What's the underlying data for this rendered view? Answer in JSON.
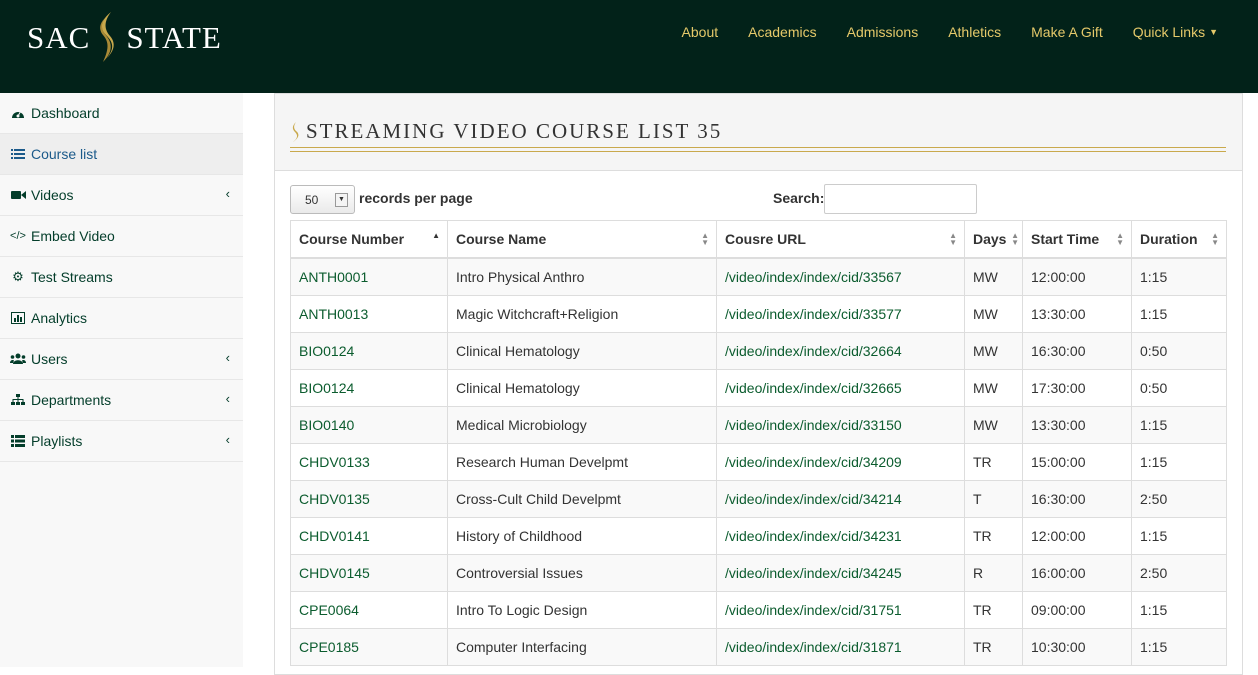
{
  "brand": {
    "left": "SAC",
    "right": "STATE",
    "logo_icon": "flame-s-icon",
    "gold": "#c9a94c",
    "header_bg": "#022219"
  },
  "topnav": [
    {
      "label": "About"
    },
    {
      "label": "Academics"
    },
    {
      "label": "Admissions"
    },
    {
      "label": "Athletics"
    },
    {
      "label": "Make A Gift"
    },
    {
      "label": "Quick Links"
    }
  ],
  "sidebar": {
    "items": [
      {
        "label": "Dashboard",
        "icon": "dashboard-icon"
      },
      {
        "label": "Course list",
        "icon": "list-icon"
      },
      {
        "label": "Videos",
        "icon": "video-camera-icon"
      },
      {
        "label": "Embed Video",
        "icon": "code-icon"
      },
      {
        "label": "Test Streams",
        "icon": "cogs-icon"
      },
      {
        "label": "Analytics",
        "icon": "bar-chart-icon"
      },
      {
        "label": "Users",
        "icon": "users-icon"
      },
      {
        "label": "Departments",
        "icon": "sitemap-icon"
      },
      {
        "label": "Playlists",
        "icon": "th-list-icon"
      }
    ]
  },
  "page": {
    "title": "STREAMING VIDEO COURSE LIST 35"
  },
  "controls": {
    "page_size": "50",
    "records_label": "records per page",
    "search_label": "Search:",
    "search_value": ""
  },
  "table": {
    "columns": [
      "Course Number",
      "Course Name",
      "Cousre URL",
      "Days",
      "Start Time",
      "Duration"
    ],
    "rows": [
      [
        "ANTH0001",
        "Intro Physical Anthro",
        "/video/index/index/cid/33567",
        "MW",
        "12:00:00",
        "1:15"
      ],
      [
        "ANTH0013",
        "Magic Witchcraft+Religion",
        "/video/index/index/cid/33577",
        "MW",
        "13:30:00",
        "1:15"
      ],
      [
        "BIO0124",
        "Clinical Hematology",
        "/video/index/index/cid/32664",
        "MW",
        "16:30:00",
        "0:50"
      ],
      [
        "BIO0124",
        "Clinical Hematology",
        "/video/index/index/cid/32665",
        "MW",
        "17:30:00",
        "0:50"
      ],
      [
        "BIO0140",
        "Medical Microbiology",
        "/video/index/index/cid/33150",
        "MW",
        "13:30:00",
        "1:15"
      ],
      [
        "CHDV0133",
        "Research Human Develpmt",
        "/video/index/index/cid/34209",
        "TR",
        "15:00:00",
        "1:15"
      ],
      [
        "CHDV0135",
        "Cross-Cult Child Develpmt",
        "/video/index/index/cid/34214",
        "T",
        "16:30:00",
        "2:50"
      ],
      [
        "CHDV0141",
        "History of Childhood",
        "/video/index/index/cid/34231",
        "TR",
        "12:00:00",
        "1:15"
      ],
      [
        "CHDV0145",
        "Controversial Issues",
        "/video/index/index/cid/34245",
        "R",
        "16:00:00",
        "2:50"
      ],
      [
        "CPE0064",
        "Intro To Logic Design",
        "/video/index/index/cid/31751",
        "TR",
        "09:00:00",
        "1:15"
      ],
      [
        "CPE0185",
        "Computer Interfacing",
        "/video/index/index/cid/31871",
        "TR",
        "10:30:00",
        "1:15"
      ]
    ]
  }
}
